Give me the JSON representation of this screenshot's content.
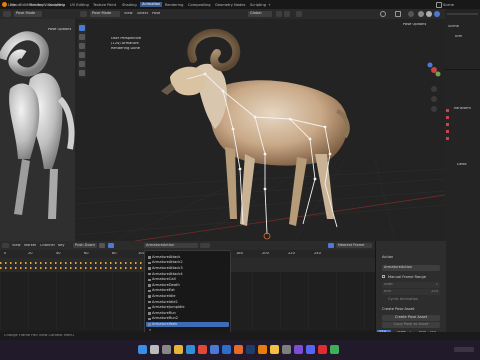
{
  "topbar": {
    "menus": [
      "File",
      "Edit",
      "Render",
      "Window",
      "Help"
    ],
    "workspaces": [
      "Layout",
      "Modeling",
      "Sculpting",
      "UV Editing",
      "Texture Paint",
      "Shading",
      "Animation",
      "Rendering",
      "Compositing",
      "Geometry Nodes",
      "Scripting"
    ],
    "active_workspace": "Animation",
    "scene_label": "Scene"
  },
  "toolbar2": {
    "mode_left": "Pose Mode",
    "mode_main": "Pose Mode",
    "menus": [
      "View",
      "Select",
      "Pose"
    ],
    "orientation": "Global",
    "pose_options_left": "Pose Options",
    "pose_options_main": "Pose Options"
  },
  "viewport": {
    "info_line1": "User Perspective",
    "info_line2": "(124) Armature",
    "info_line3": "Rendering Done"
  },
  "right_panel": {
    "items": [
      "Scene",
      "Arm",
      "Transform",
      "Delta"
    ]
  },
  "timeline": {
    "menus": [
      "View",
      "Marker",
      "Channel",
      "Key"
    ],
    "push_down_label": "Push Down",
    "action_name": "ArmatureAction",
    "ruler_labels": [
      "0",
      "20",
      "40",
      "60",
      "80",
      "100",
      "120",
      "140",
      "160",
      "180",
      "200",
      "220",
      "240"
    ],
    "nearest_frame": "Nearest Frame"
  },
  "dropdown": {
    "items": [
      "ArmatureAttack",
      "ArmatureAttack2",
      "ArmatureAttack3",
      "ArmatureAttack4",
      "ArmatureCall",
      "ArmatureDeath",
      "ArmatureEat",
      "ArmatureIdle",
      "ArmatureIdle2",
      "ArmatureJumpIdle",
      "ArmatureRun",
      "ArmatureRun2",
      "ArmatureWalk"
    ],
    "selected_index": 12,
    "search_glyph": "⌕"
  },
  "action_panel": {
    "section_action": "Action",
    "action_value": "ArmatureAction",
    "manual_frame_range": "Manual Frame Range",
    "start_label": "Start",
    "end_label": "End",
    "cyclic_label": "Cyclic Animation",
    "section_pose_asset": "Create Pose Asset",
    "create_pose_asset_btn": "Create Pose Asset",
    "copy_pose_btn": "Copy Pose as Asset",
    "start_value": "1",
    "end_value": "250"
  },
  "playback": {
    "current_frame": "124",
    "start_label": "Start",
    "start_value": "1",
    "end_label": "End",
    "end_value": "250"
  },
  "status": {
    "text": "Change Frame   Pan View   Context Menu"
  },
  "taskbar": {
    "icons": [
      "windows-icon",
      "search-icon",
      "taskview-icon",
      "explorer-icon",
      "edge-icon",
      "chrome-icon",
      "store-icon",
      "photoshop-icon",
      "firefox-icon",
      "steam-icon",
      "blender-icon",
      "files-icon",
      "settings-icon",
      "viber-icon",
      "discord-icon",
      "youtube-icon",
      "notes-icon"
    ],
    "colors": [
      "#3a8ee6",
      "#bbbbbb",
      "#888888",
      "#e5b53a",
      "#2f8fd8",
      "#e0493a",
      "#4a7ad8",
      "#2d6ecb",
      "#e66a2c",
      "#1f3c6a",
      "#e87d0d",
      "#f0c040",
      "#7e7e7e",
      "#7b4fd0",
      "#5865f2",
      "#e02d2d",
      "#3fb05a"
    ]
  },
  "colors": {
    "accent": "#3b5a89",
    "selection": "#3e6bb5",
    "keyframe": "#e9a629",
    "playhead": "#4b7ad6"
  }
}
